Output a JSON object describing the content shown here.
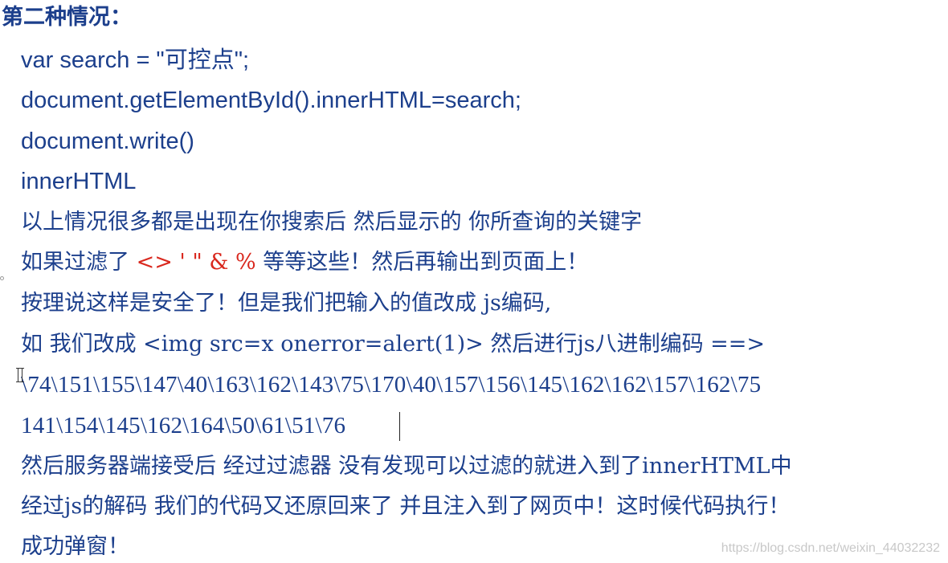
{
  "heading": "第二种情况：",
  "code_lines": [
    "var search = \"可控点\";",
    "document.getElementById().innerHTML=search;",
    "document.write()",
    "innerHTML"
  ],
  "line_observation": "以上情况很多都是出现在你搜索后 然后显示的 你所查询的关键字",
  "line_filter": {
    "prefix": "如果过滤了 ",
    "chars": "<> ' \" & %",
    "suffix": " 等等这些！然后再输出到页面上！"
  },
  "line_safe": "按理说这样是安全了！但是我们把输入的值改成 js编码,",
  "line_example": "如 我们改成 <img src=x onerror=alert(1)> 然后进行js八进制编码 ==>",
  "encoded_line_1": "\\74\\151\\155\\147\\40\\163\\162\\143\\75\\170\\40\\157\\156\\145\\162\\162\\157\\162\\75",
  "encoded_line_2": "141\\154\\145\\162\\164\\50\\61\\51\\76",
  "line_server": "然后服务器端接受后 经过过滤器 没有发现可以过滤的就进入到了innerHTML中",
  "line_decode": "经过js的解码 我们的代码又还原回来了 并且注入到了网页中！这时候代码执行！",
  "line_result": "成功弹窗！",
  "watermark": "https://blog.csdn.net/weixin_44032232",
  "colors": {
    "text": "#1c3f8c",
    "highlight": "#d9281e"
  }
}
